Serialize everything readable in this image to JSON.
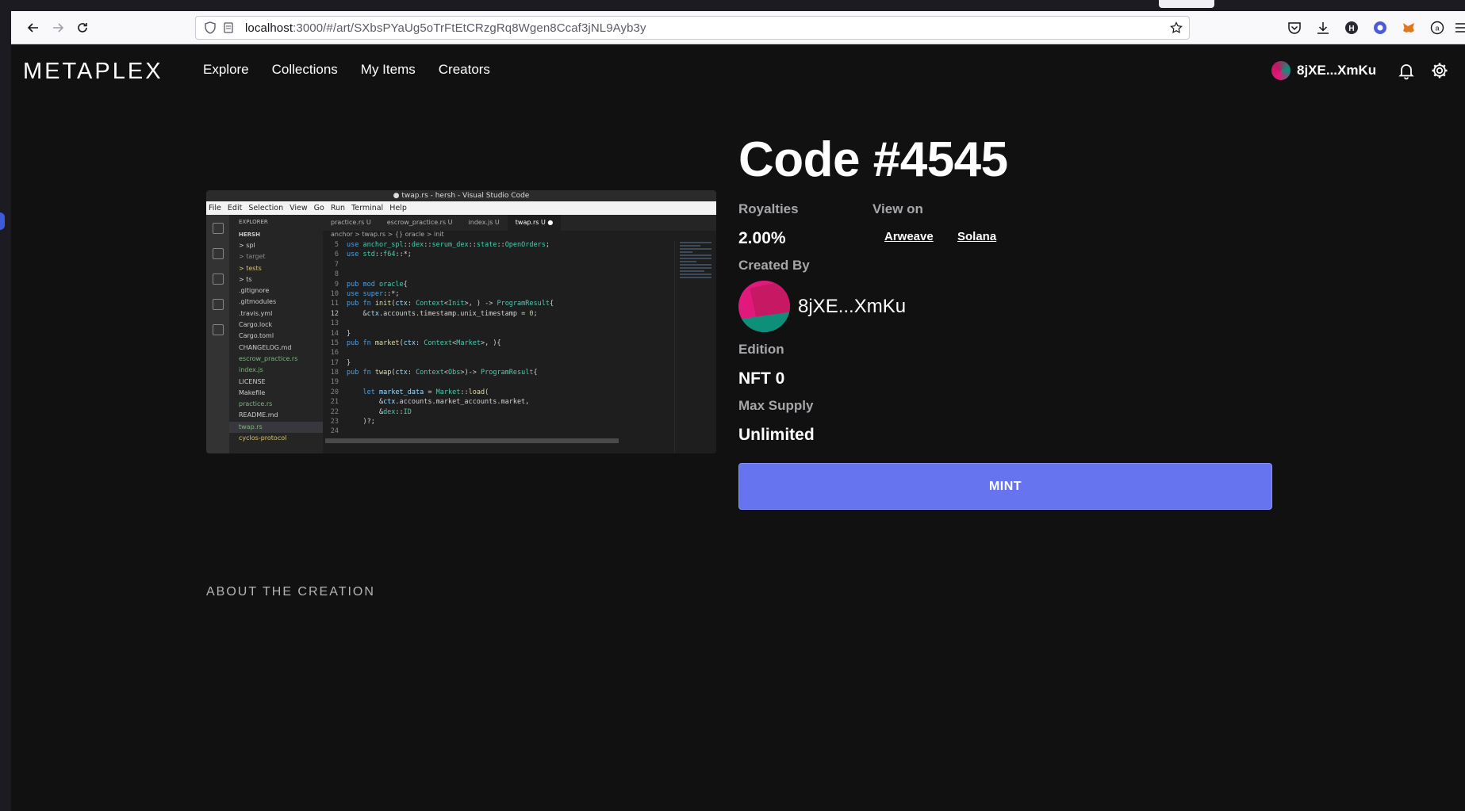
{
  "browser": {
    "url_host": "localhost",
    "url_rest": ":3000/#/art/SXbsPYaUg5oTrFtEtCRzgRq8Wgen8Ccaf3jNL9Ayb3y",
    "toolbar_icons": [
      "pocket-icon",
      "download-icon",
      "extension-h-icon",
      "extension-icon",
      "metamask-icon",
      "extension-a-icon",
      "menu-icon"
    ]
  },
  "app": {
    "logo": "METAPLEX",
    "menu": [
      "Explore",
      "Collections",
      "My Items",
      "Creators"
    ],
    "wallet_address": "8jXE...XmKu"
  },
  "art_image": {
    "window_title": "● twap.rs - hersh - Visual Studio Code",
    "menu": [
      "File",
      "Edit",
      "Selection",
      "View",
      "Go",
      "Run",
      "Terminal",
      "Help"
    ],
    "explorer_title": "EXPLORER",
    "explorer_root": "HERSH",
    "files": [
      "> spl",
      "> target",
      "> tests",
      "> ts",
      ".gitignore",
      ".gitmodules",
      ".travis.yml",
      "Cargo.lock",
      "Cargo.toml",
      "CHANGELOG.md",
      "escrow_practice.rs",
      "index.js",
      "LICENSE",
      "Makefile",
      "practice.rs",
      "README.md",
      "twap.rs",
      "cyclos-protocol"
    ],
    "tabs": [
      "practice.rs U",
      "escrow_practice.rs U",
      "index.js U",
      "twap.rs U ●"
    ],
    "breadcrumb": "anchor > twap.rs > {} oracle > init"
  },
  "nft": {
    "title": "Code #4545",
    "royalties_label": "Royalties",
    "royalties_value": "2.00%",
    "view_on_label": "View on",
    "view_links": [
      "Arweave",
      "Solana"
    ],
    "created_by_label": "Created By",
    "creator": "8jXE...XmKu",
    "edition_label": "Edition",
    "edition_value": "NFT 0",
    "max_supply_label": "Max Supply",
    "max_supply_value": "Unlimited",
    "mint_label": "MINT",
    "about_label": "ABOUT THE CREATION"
  }
}
